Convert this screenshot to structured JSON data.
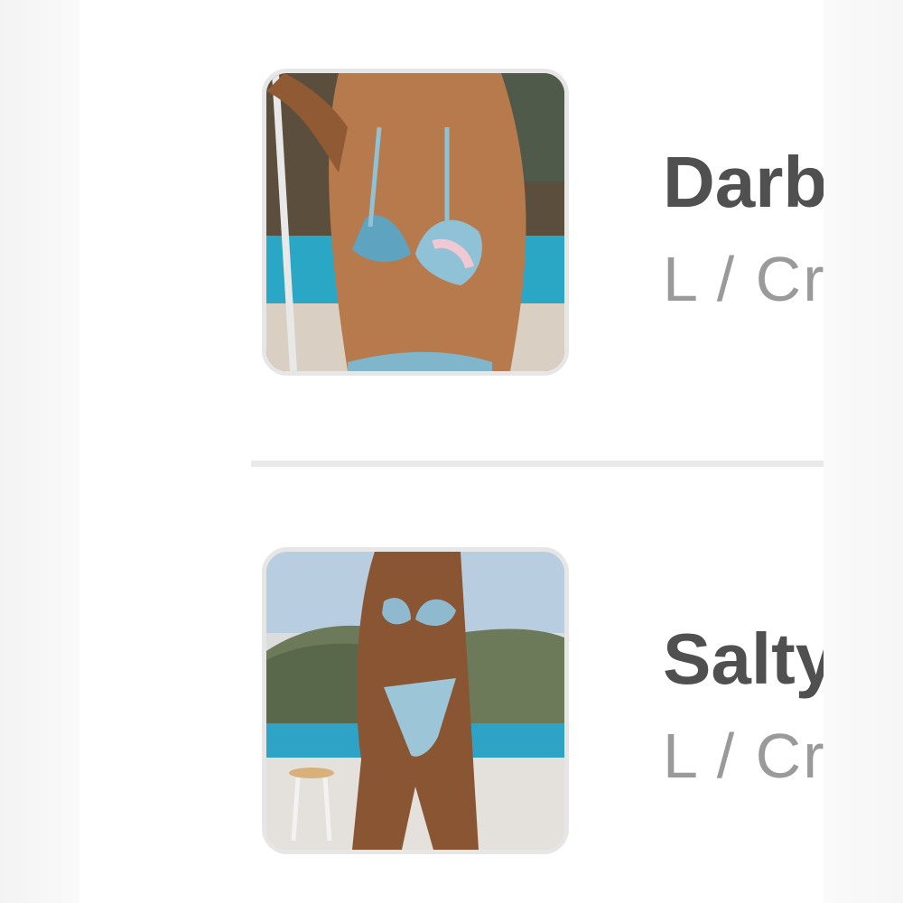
{
  "cart": {
    "items": [
      {
        "image_alt": "Model wearing blue and pink floral bikini by a pool",
        "title": "Darb",
        "subtitle": "L / Cr"
      },
      {
        "image_alt": "Model wearing blue and white floral bikini on a terrace with hills behind",
        "title": "Salty",
        "subtitle": "L / Cr"
      }
    ]
  },
  "colors": {
    "panel_background": "#ffffff",
    "page_background": "#f6f6f6",
    "title_text": "#505050",
    "subtitle_text": "#9a9a9a",
    "divider": "#e9e9e9",
    "thumb_border": "#e6e6e6"
  }
}
